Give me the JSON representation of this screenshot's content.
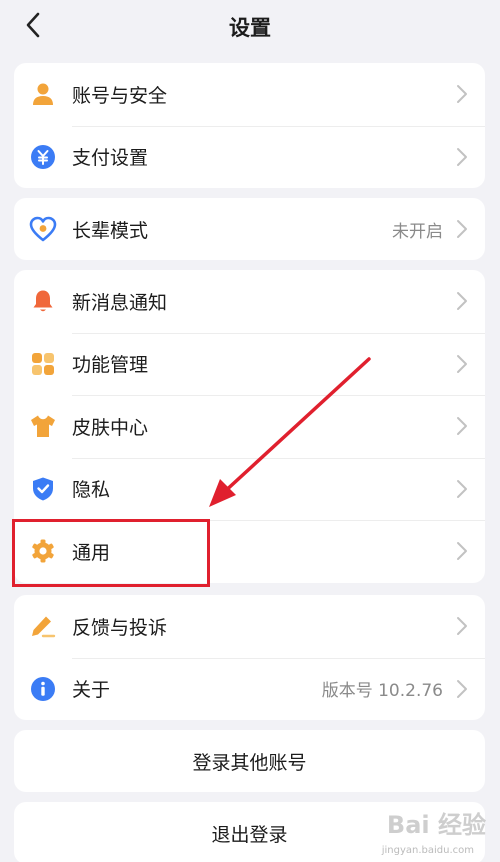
{
  "header": {
    "title": "设置",
    "back_icon": "chevron-left-icon"
  },
  "groups": [
    {
      "items": [
        {
          "label": "账号与安全",
          "icon": "person-icon",
          "color": "#f2a43a"
        },
        {
          "label": "支付设置",
          "icon": "yuan-icon",
          "color": "#3b7cf5"
        }
      ]
    },
    {
      "items": [
        {
          "label": "长辈模式",
          "value": "未开启",
          "icon": "heart-icon",
          "color": "#3b7cf5"
        }
      ]
    },
    {
      "items": [
        {
          "label": "新消息通知",
          "icon": "bell-icon",
          "color": "#f0673a"
        },
        {
          "label": "功能管理",
          "icon": "grid-icon",
          "color": "#f2a43a"
        },
        {
          "label": "皮肤中心",
          "icon": "shirt-icon",
          "color": "#f2a43a"
        },
        {
          "label": "隐私",
          "icon": "shield-icon",
          "color": "#3b7cf5"
        },
        {
          "label": "通用",
          "icon": "gear-icon",
          "color": "#f2a43a"
        }
      ]
    },
    {
      "items": [
        {
          "label": "反馈与投诉",
          "icon": "pencil-icon",
          "color": "#f2a43a"
        },
        {
          "label": "关于",
          "value": "版本号 10.2.76",
          "icon": "info-icon",
          "color": "#3b7cf5"
        }
      ]
    }
  ],
  "actions": {
    "switch_account": "登录其他账号",
    "logout": "退出登录"
  },
  "annotation": {
    "color": "#e0202e"
  },
  "watermark": {
    "text": "Bai 经验",
    "url": "jingyan.baidu.com"
  }
}
